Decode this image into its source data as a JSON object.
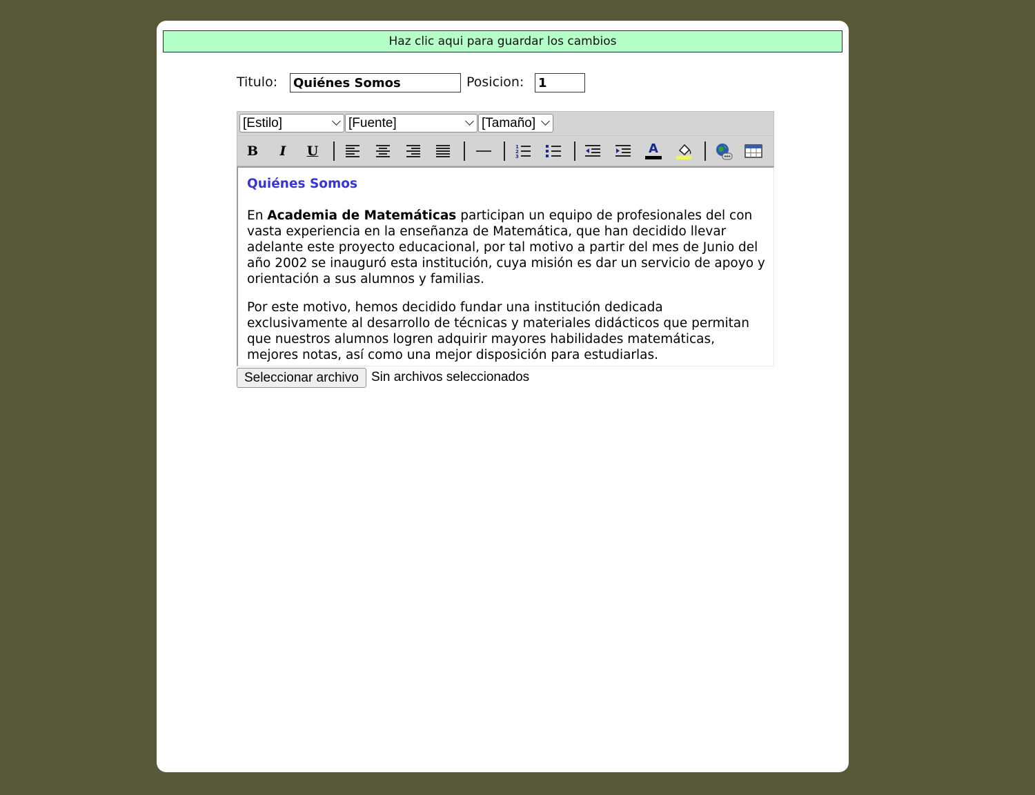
{
  "save_bar": {
    "label": "Haz clic aqui para guardar los cambios",
    "color": "#b3ffc7"
  },
  "form": {
    "title_label": "Titulo:",
    "title_value": "Quiénes Somos",
    "position_label": "Posicion:",
    "position_value": "1"
  },
  "toolbar": {
    "style_select": "[Estilo]",
    "font_select": "[Fuente]",
    "size_select": "[Tamaño]",
    "buttons": {
      "bold": "B",
      "italic": "I",
      "underline": "U",
      "font_color_letter": "A"
    }
  },
  "editor": {
    "heading": "Quiénes Somos",
    "heading_color": "#3535d8",
    "p1_intro": "En ",
    "p1_bold": "Academia de Matemáticas",
    "p1_rest": " participan un equipo de profesionales del con vasta experiencia en la enseñanza de Matemática, que han decidido llevar adelante este proyecto educacional, por tal motivo a partir del mes de Junio  del año 2002 se inauguró esta institución, cuya misión es dar un servicio de apoyo y orientación a sus alumnos y familias.",
    "p2": "Por este motivo, hemos decidido fundar una institución dedicada exclusivamente al desarrollo de técnicas y materiales didácticos que permitan que nuestros alumnos logren adquirir mayores habilidades matemáticas, mejores notas, así como una mejor disposición para estudiarlas."
  },
  "file_upload": {
    "button_label": "Seleccionar archivo",
    "status": "Sin archivos seleccionados"
  },
  "colors": {
    "page_background": "#575938",
    "panel": "#ffffff",
    "toolbar": "#d4d4d4"
  }
}
